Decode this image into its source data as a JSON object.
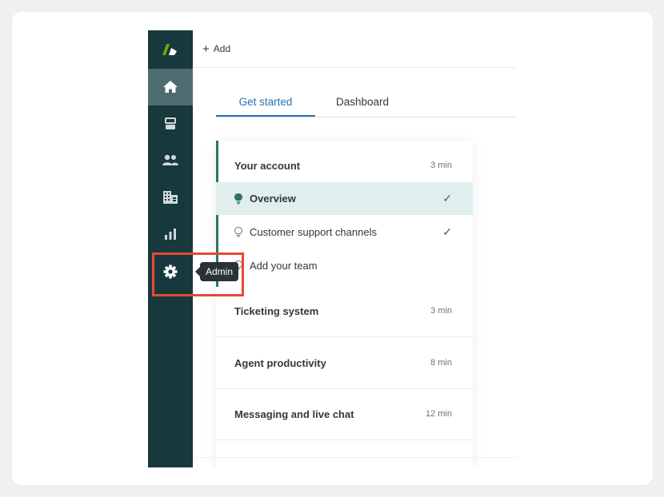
{
  "topbar": {
    "add_label": "Add",
    "plus": "+"
  },
  "tabs": [
    {
      "label": "Get started",
      "active": true
    },
    {
      "label": "Dashboard",
      "active": false
    }
  ],
  "sidebar": {
    "items": [
      {
        "icon": "home-icon",
        "active": true
      },
      {
        "icon": "tickets-icon",
        "active": false
      },
      {
        "icon": "customers-icon",
        "active": false
      },
      {
        "icon": "organizations-icon",
        "active": false
      },
      {
        "icon": "reporting-icon",
        "active": false
      },
      {
        "icon": "gear-icon",
        "active": false,
        "tooltip": "Admin"
      }
    ]
  },
  "tooltip": {
    "text": "Admin"
  },
  "checklist": {
    "your_account": {
      "title": "Your account",
      "time": "3 min",
      "items": [
        {
          "label": "Overview",
          "done": true,
          "check": "✓"
        },
        {
          "label": "Customer support channels",
          "done": true,
          "check": "✓"
        },
        {
          "label": "Add your team",
          "done": false
        }
      ]
    },
    "sections": [
      {
        "title": "Ticketing system",
        "time": "3 min"
      },
      {
        "title": "Agent productivity",
        "time": "8 min"
      },
      {
        "title": "Messaging and live chat",
        "time": "12 min"
      }
    ]
  },
  "colors": {
    "sidebar": "#17383c",
    "active_tab": "#1f73b7",
    "accent": "#2f7367",
    "highlight": "#e34b33",
    "logo_green": "#78a300"
  }
}
